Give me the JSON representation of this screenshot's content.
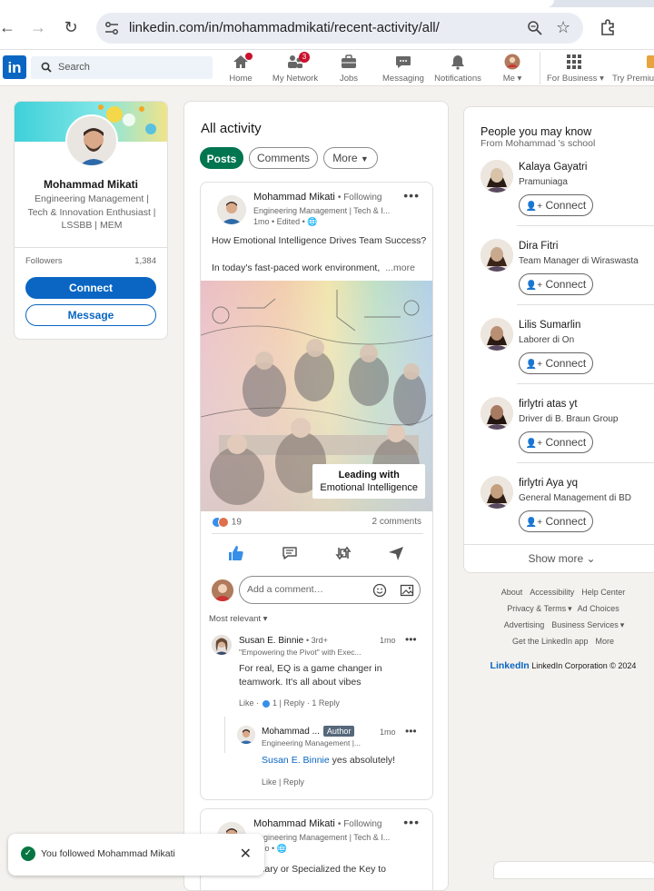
{
  "browser": {
    "url": "linkedin.com/in/mohammadmikati/recent-activity/all/"
  },
  "nav": {
    "logo": "in",
    "search_placeholder": "Search",
    "items": [
      {
        "label": "Home",
        "icon": "home-icon"
      },
      {
        "label": "My Network",
        "icon": "network-icon",
        "badge": "3"
      },
      {
        "label": "Jobs",
        "icon": "briefcase-icon"
      },
      {
        "label": "Messaging",
        "icon": "messaging-icon"
      },
      {
        "label": "Notifications",
        "icon": "bell-icon"
      },
      {
        "label": "Me",
        "icon": "avatar"
      },
      {
        "label": "For Business",
        "icon": "grid-icon"
      },
      {
        "label": "Try Premium",
        "icon": "premium-icon"
      }
    ]
  },
  "profile": {
    "name": "Mohammad Mikati",
    "headline": "Engineering Management | Tech & Innovation Enthusiast | LSSBB | MEM",
    "followers_label": "Followers",
    "followers_count": "1,384",
    "connect_label": "Connect",
    "message_label": "Message"
  },
  "activity": {
    "title": "All activity",
    "tabs": [
      "Posts",
      "Comments",
      "More"
    ],
    "post": {
      "author": "Mohammad Mikati",
      "following": "• Following",
      "author_sub": "Engineering Management | Tech & I...",
      "meta": "1mo • Edited •",
      "line1": "How Emotional Intelligence Drives Team Success?",
      "line2": "In today's fast-paced work environment,",
      "more": "...more",
      "image_caption1": "Leading with",
      "image_caption2": "Emotional Intelligence",
      "reaction_count": "19",
      "comments_count": "2 comments",
      "comment_placeholder": "Add a comment…",
      "sort_label": "Most relevant"
    },
    "comments": [
      {
        "name": "Susan E. Binnie",
        "degree": "• 3rd+",
        "sub": "\"Empowering the Pivot\" with Exec...",
        "time": "1mo",
        "text": "For real, EQ is a game changer in teamwork. It's all about vibes",
        "like": "Like",
        "like_count": "1",
        "reply": "Reply",
        "reply_count": "1 Reply"
      },
      {
        "name": "Mohammad ...",
        "badge": "Author",
        "sub": "Engineering Management |...",
        "time": "1mo",
        "mention": "Susan E. Binnie",
        "text": "yes absolutely!",
        "like": "Like",
        "reply": "Reply"
      }
    ],
    "post2": {
      "author": "Mohammad Mikati",
      "following": "• Following",
      "author_sub": "Engineering Management | Tech & I...",
      "meta": "1mo •",
      "line1": "Interdisciplinary or Specialized the Key to"
    }
  },
  "suggestions": {
    "title": "People you may know",
    "subtitle": "From Mohammad 's school",
    "connect_label": "Connect",
    "people": [
      {
        "name": "Kalaya Gayatri",
        "headline": "Pramuniaga"
      },
      {
        "name": "Dira Fitri",
        "headline": "Team Manager di Wiraswasta"
      },
      {
        "name": "Lilis Sumarlin",
        "headline": "Laborer di On"
      },
      {
        "name": "firlytri atas yt",
        "headline": "Driver di B. Braun Group"
      },
      {
        "name": "firlytri Aya yq",
        "headline": "General Management di BD"
      }
    ],
    "show_more": "Show more"
  },
  "footer": {
    "rows": [
      [
        "About",
        "Accessibility",
        "Help Center"
      ],
      [
        "Privacy & Terms",
        "Ad Choices"
      ],
      [
        "Advertising",
        "Business Services"
      ],
      [
        "Get the LinkedIn app",
        "More"
      ]
    ],
    "brand": "LinkedIn",
    "copyright": "LinkedIn Corporation © 2024"
  },
  "toast": {
    "text": "You followed Mohammad Mikati"
  },
  "colors": {
    "brand_blue": "#0a66c2",
    "green_active": "#01754f",
    "badge_red": "#cb112d"
  }
}
